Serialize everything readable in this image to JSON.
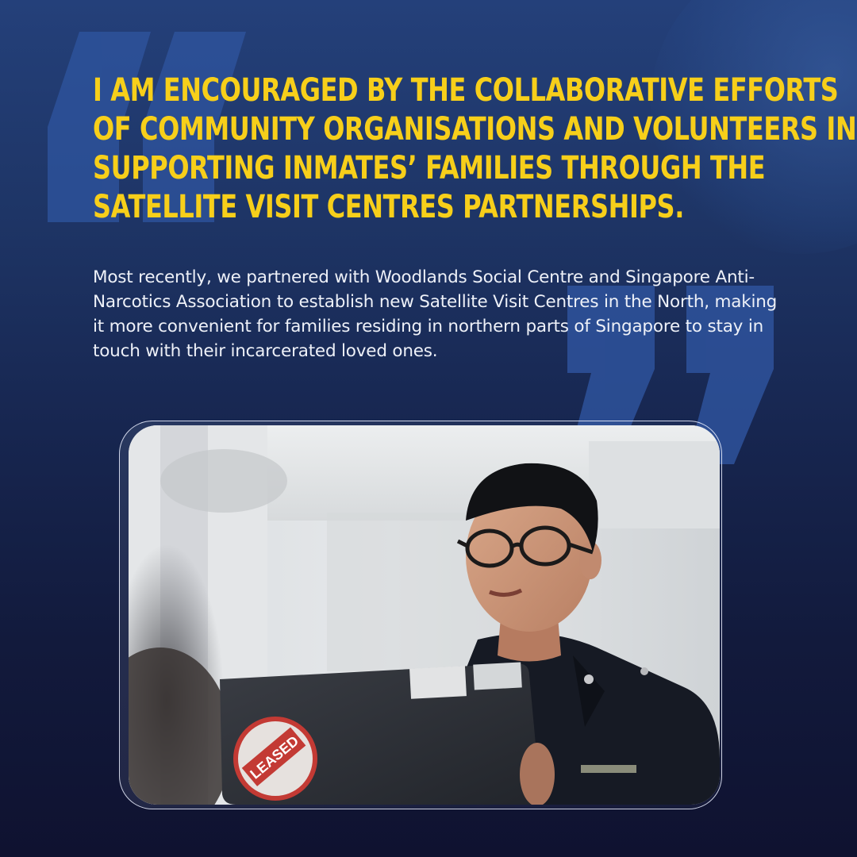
{
  "headline": {
    "lines": [
      "I am encouraged by the collaborative efforts",
      "of community organisations and volunteers in",
      "supporting inmates’ families through the",
      "Satellite Visit Centres partnerships."
    ]
  },
  "body": {
    "text": "Most recently, we partnered with Woodlands Social Centre and Singapore Anti-Narcotics Association to establish new Satellite Visit Centres in the North, making it more convenient for families residing in northern parts of Singapore to stay in touch with their incarcerated loved ones."
  },
  "photo": {
    "sticker_text": "LEASED",
    "icon": "officer-photo"
  },
  "colors": {
    "headline": "#f7cf1a",
    "background_top": "#24407a",
    "background_bottom": "#0f1230",
    "quote_mark": "#2f55a0"
  }
}
